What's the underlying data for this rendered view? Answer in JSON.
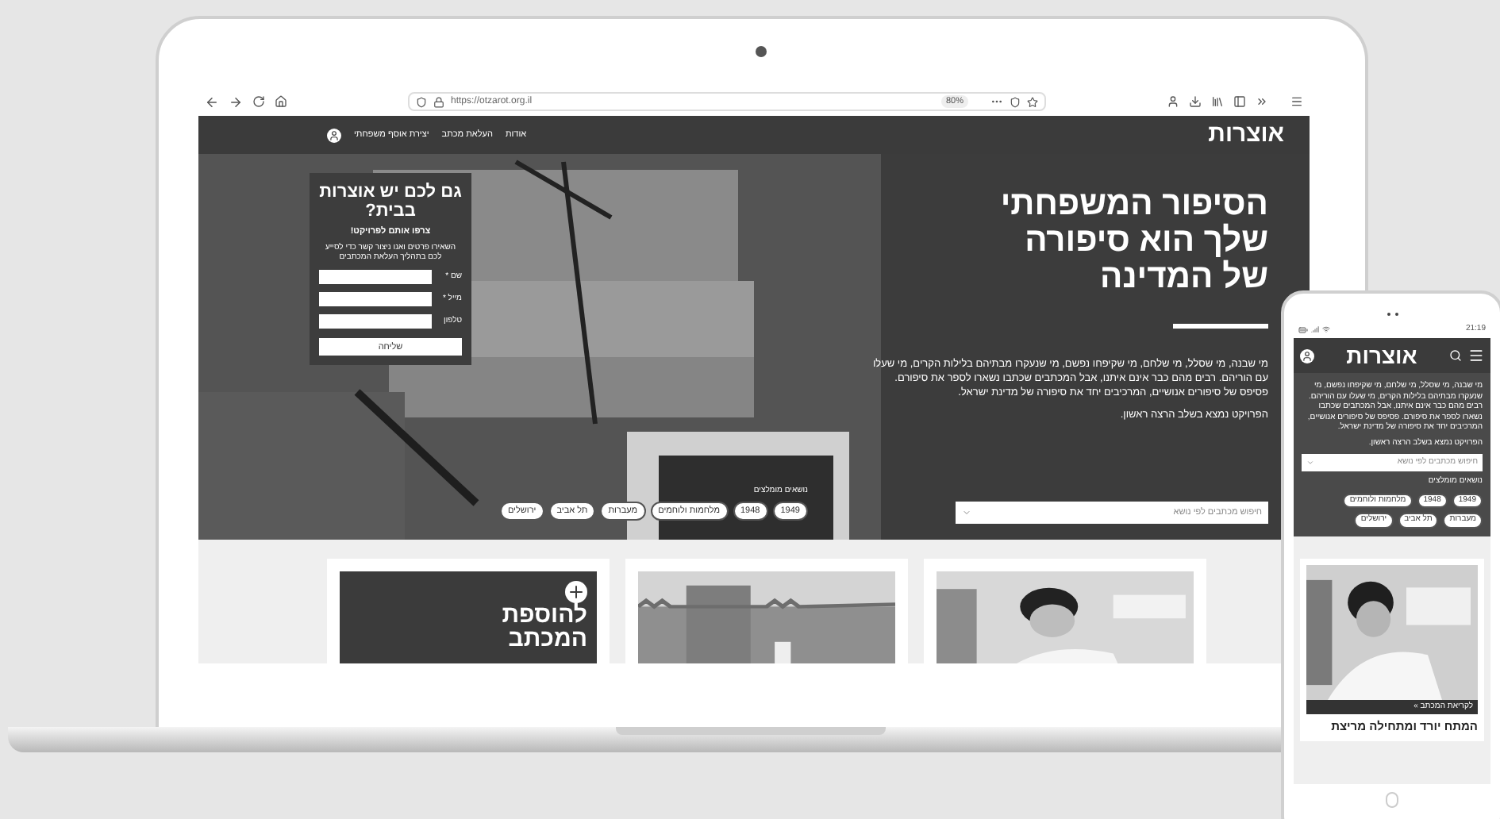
{
  "browser": {
    "url": "https://otzarot.org.il",
    "zoom": "80%"
  },
  "site_nav": {
    "logo": "אוצרות",
    "links": [
      "אודות",
      "העלאת מכתב",
      "יצירת אוסף משפחתי"
    ]
  },
  "hero": {
    "title_lines": [
      "הסיפור המשפחתי",
      "שלך הוא סיפורה",
      "של המדינה"
    ],
    "body": "מי שבנה, מי שסלל, מי שלחם, מי שקיפחו נפשם, מי שנעקרו מבתיהם בלילות הקרים, מי שעלו עם הוריהם. רבים מהם כבר אינם איתנו, אבל המכתבים שכתבו נשארו לספר את סיפורם. פסיפס של סיפורים אנושיים, המרכיבים יחד את סיפורה של מדינת ישראל.",
    "note": "הפרויקט נמצא בשלב הרצה ראשון.",
    "search": {
      "placeholder": "חיפוש מכתבים לפי נושא"
    },
    "tags_label": "נושאים מומלצים",
    "tags": [
      "1949",
      "1948",
      "מלחמות ולוחמים",
      "מעברות",
      "תל אביב",
      "ירושלים"
    ]
  },
  "form": {
    "title": "גם לכם יש אוצרות בבית?",
    "subtitle": "צרפו אותם לפרויקט!",
    "description": "השאירו פרטים ואנו ניצור קשר כדי לסייע לכם בתהליך העלאת המכתבים",
    "fields": [
      {
        "label": "שם *"
      },
      {
        "label": "מייל *"
      },
      {
        "label": "טלפון"
      }
    ],
    "submit": "שליחה"
  },
  "cards": [
    {
      "kind": "portrait"
    },
    {
      "kind": "cityscape"
    },
    {
      "kind": "add",
      "title_lines": [
        "להוספת",
        "המכתב"
      ]
    }
  ],
  "phone": {
    "time": "21:19",
    "logo": "אוצרות",
    "body": "מי שבנה, מי שסלל, מי שלחם, מי שקיפחו נפשם, מי שנעקרו מבתיהם בלילות הקרים, מי שעלו עם הוריהם. רבים מהם כבר אינם איתנו, אבל המכתבים שכתבו נשארו לספר את סיפורם. פסיפס של סיפורים אנושיים, המרכיבים יחד את סיפורה של מדינת ישראל.",
    "note": "הפרויקט נמצא בשלב הרצה ראשון.",
    "search": {
      "placeholder": "חיפוש מכתבים לפי נושא"
    },
    "tags_label": "נושאים מומלצים",
    "tags": [
      "1949",
      "1948",
      "מלחמות ולוחמים",
      "מעברות",
      "תל אביב",
      "ירושלים"
    ],
    "card": {
      "caption": "לקריאת המכתב »",
      "title": "המתח יורד ומתחילה מריצת"
    }
  }
}
